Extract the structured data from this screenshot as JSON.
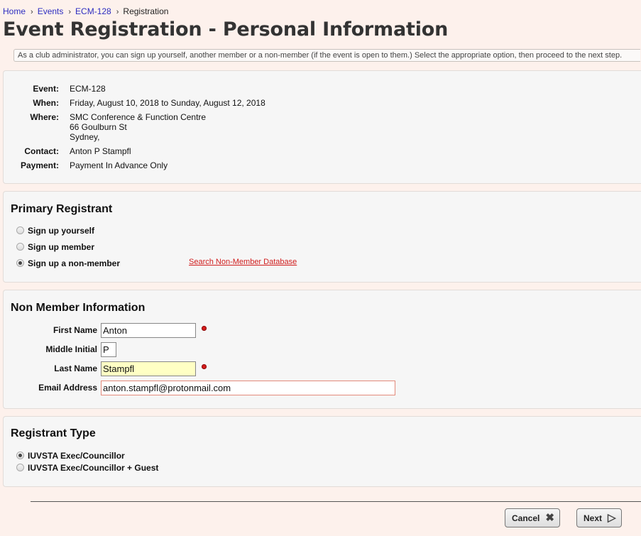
{
  "breadcrumb": {
    "home": "Home",
    "events": "Events",
    "event": "ECM-128",
    "current": "Registration",
    "separator": "›"
  },
  "page": {
    "title": "Event Registration - Personal Information",
    "notice": "As a club administrator, you can sign up yourself, another member or a non-member (if the event is open to them.) Select the appropriate option, then proceed to the next step."
  },
  "event": {
    "event_label": "Event:",
    "event_value": "ECM-128",
    "when_label": "When:",
    "when_value": "Friday, August 10, 2018 to Sunday, August 12, 2018",
    "where_label": "Where:",
    "where_line1": "SMC Conference & Function Centre",
    "where_line2": "66 Goulburn St",
    "where_line3": "Sydney,",
    "contact_label": "Contact:",
    "contact_value": "Anton P Stampfl",
    "payment_label": "Payment:",
    "payment_value": "Payment In Advance Only"
  },
  "primary": {
    "heading": "Primary Registrant",
    "options": [
      {
        "label": "Sign up yourself",
        "checked": false
      },
      {
        "label": "Sign up member",
        "checked": false
      },
      {
        "label": "Sign up a non-member",
        "checked": true
      }
    ],
    "search_link": "Search Non-Member Database"
  },
  "nonmember": {
    "heading": "Non Member Information",
    "first_name_label": "First Name",
    "first_name": "Anton",
    "middle_initial_label": "Middle Initial",
    "middle_initial": "P",
    "last_name_label": "Last Name",
    "last_name": "Stampfl",
    "email_label": "Email Address",
    "email": "anton.stampfl@protonmail.com"
  },
  "registrant_type": {
    "heading": "Registrant Type",
    "options": [
      {
        "label": "IUVSTA Exec/Councillor",
        "checked": true
      },
      {
        "label": "IUVSTA Exec/Councillor + Guest",
        "checked": false
      }
    ]
  },
  "buttons": {
    "cancel": "Cancel",
    "next": "Next"
  },
  "icons": {
    "cancel": "close-icon",
    "next": "play-arrow-icon"
  }
}
